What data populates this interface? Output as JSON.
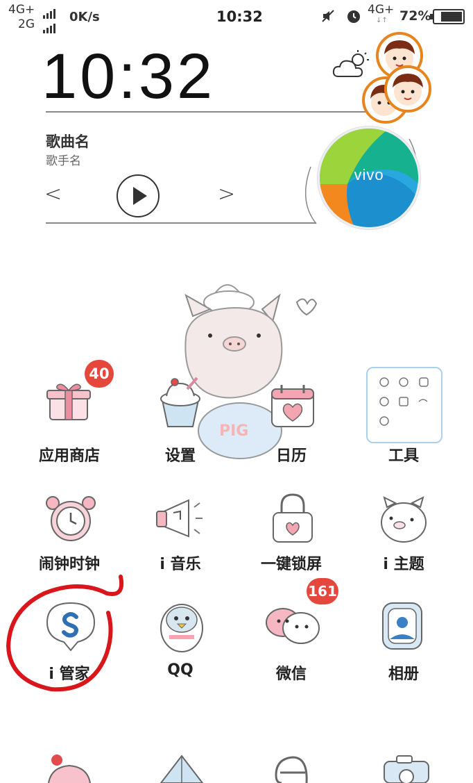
{
  "status_bar": {
    "net1": "4G+",
    "net2": "2G",
    "speed": "0K/s",
    "time": "10:32",
    "net3": "4G+",
    "battery": "72%"
  },
  "clock_widget": {
    "time": "10:32"
  },
  "music_widget": {
    "song": "歌曲名",
    "artist": "歌手名",
    "prev": "<",
    "next": ">"
  },
  "vivo_logo": "vivo",
  "apps": [
    {
      "label": "应用商店",
      "badge": "40",
      "icon": "gift-box-icon"
    },
    {
      "label": "设置",
      "badge": "",
      "icon": "ice-cream-icon"
    },
    {
      "label": "日历",
      "badge": "",
      "icon": "calendar-heart-icon"
    },
    {
      "label": "工具",
      "badge": "",
      "icon": "tools-folder-icon"
    },
    {
      "label": "闹钟时钟",
      "badge": "",
      "icon": "alarm-clock-icon"
    },
    {
      "label": "i 音乐",
      "badge": "",
      "icon": "megaphone-icon"
    },
    {
      "label": "一键锁屏",
      "badge": "",
      "icon": "padlock-icon"
    },
    {
      "label": "i 主题",
      "badge": "",
      "icon": "pig-face-icon"
    },
    {
      "label": "i 管家",
      "badge": "",
      "icon": "shield-s-icon"
    },
    {
      "label": "QQ",
      "badge": "",
      "icon": "penguin-icon"
    },
    {
      "label": "微信",
      "badge": "161",
      "icon": "chat-bubbles-icon"
    },
    {
      "label": "相册",
      "badge": "",
      "icon": "photo-frame-icon"
    }
  ],
  "wallpaper_text": "PIG",
  "colors": {
    "badge": "#e6473c",
    "annotation_circle": "#d9161b",
    "avatar_ring": "#e8841e"
  }
}
